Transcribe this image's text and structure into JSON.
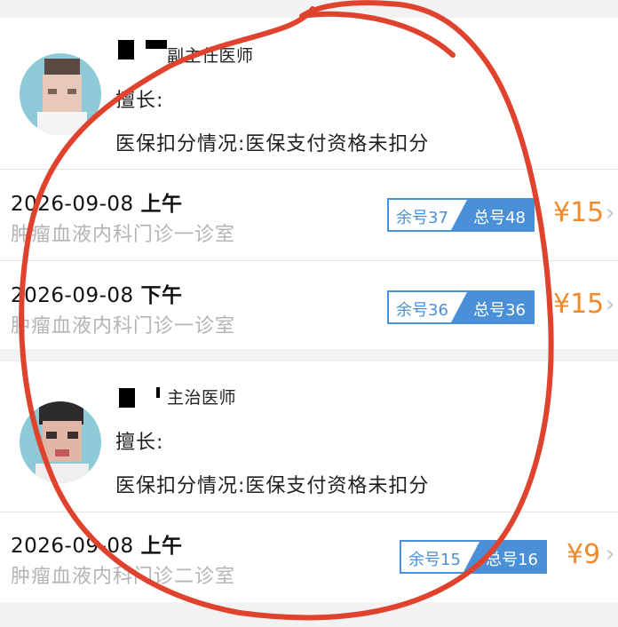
{
  "doctors": [
    {
      "title": "副主任医师",
      "specialty": "擅长:",
      "insurance": "医保扣分情况:医保支付资格未扣分",
      "slots": [
        {
          "date": "2026-09-08",
          "period": "上午",
          "dept": "肿瘤血液内科门诊一诊室",
          "remain": "余号37",
          "total": "总号48",
          "price": "¥15"
        },
        {
          "date": "2026-09-08",
          "period": "下午",
          "dept": "肿瘤血液内科门诊一诊室",
          "remain": "余号36",
          "total": "总号36",
          "price": "¥15"
        }
      ]
    },
    {
      "title": "主治医师",
      "specialty": "擅长:",
      "insurance": "医保扣分情况:医保支付资格未扣分",
      "slots": [
        {
          "date": "2026-09-08",
          "period": "上午",
          "dept": "肿瘤血液内科门诊二诊室",
          "remain": "余号15",
          "total": "总号16",
          "price": "¥9"
        }
      ]
    }
  ],
  "icons": {
    "chevron": "›"
  },
  "colors": {
    "accent": "#4a90d9",
    "price": "#f08a2b",
    "annotation": "#e0432d"
  }
}
